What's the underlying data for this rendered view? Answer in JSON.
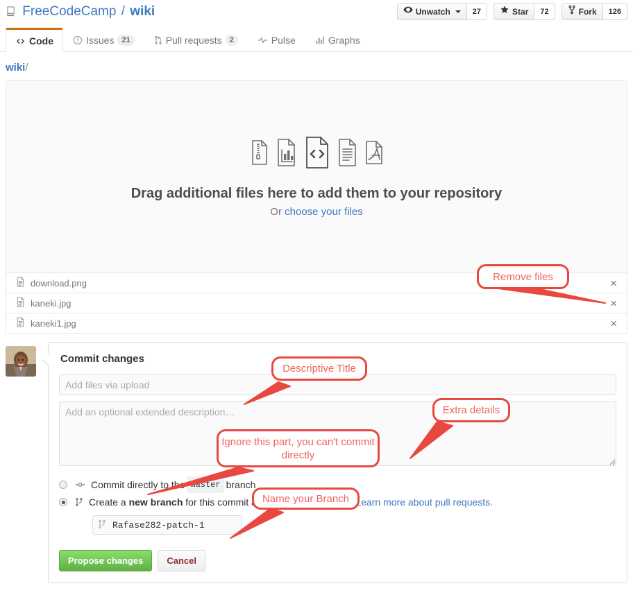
{
  "header": {
    "repo_icon": "repo-forked-icon",
    "owner": "FreeCodeCamp",
    "separator": "/",
    "name": "wiki",
    "actions": [
      {
        "icon": "eye-icon",
        "label": "Unwatch",
        "has_caret": true,
        "count": "27"
      },
      {
        "icon": "star-icon",
        "label": "Star",
        "has_caret": false,
        "count": "72"
      },
      {
        "icon": "fork-icon",
        "label": "Fork",
        "has_caret": false,
        "count": "126"
      }
    ]
  },
  "nav": {
    "tabs": [
      {
        "icon": "code-icon",
        "label": "Code",
        "count": "",
        "selected": true
      },
      {
        "icon": "issue-opened-icon",
        "label": "Issues",
        "count": "21",
        "selected": false
      },
      {
        "icon": "git-pull-request-icon",
        "label": "Pull requests",
        "count": "2",
        "selected": false
      },
      {
        "icon": "pulse-icon",
        "label": "Pulse",
        "count": "",
        "selected": false
      },
      {
        "icon": "graph-icon",
        "label": "Graphs",
        "count": "",
        "selected": false
      }
    ]
  },
  "breadcrumb": {
    "root": "wiki",
    "slash": "/"
  },
  "dropzone": {
    "file_type_icons": [
      "zip-file-icon",
      "spreadsheet-file-icon",
      "code-file-icon",
      "text-file-icon",
      "pdf-file-icon"
    ],
    "title": "Drag additional files here to add them to your repository",
    "or_text": "Or ",
    "choose_link": "choose your files"
  },
  "uploaded_files": [
    {
      "icon": "file-icon",
      "name": "download.png",
      "remove": "×"
    },
    {
      "icon": "file-icon",
      "name": "kaneki.jpg",
      "remove": "×"
    },
    {
      "icon": "file-icon",
      "name": "kaneki1.jpg",
      "remove": "×"
    }
  ],
  "commit": {
    "avatar_name": "user-avatar",
    "heading": "Commit changes",
    "title_placeholder": "Add files via upload",
    "title_value": "",
    "description_placeholder": "Add an optional extended description…",
    "description_value": "",
    "option_direct": {
      "icon": "git-commit-icon",
      "text_before": "Commit directly to the",
      "branch": "master",
      "text_after": "branch",
      "checked": false
    },
    "option_branch": {
      "icon": "git-branch-icon",
      "text_before": "Create a",
      "bold": "new branch",
      "text_after": "for this commit and start a pull request.",
      "link": "Learn more about pull requests.",
      "checked": true
    },
    "branch_name_icon": "git-branch-icon",
    "branch_name_value": "Rafase282-patch-1",
    "propose_label": "Propose changes",
    "cancel_label": "Cancel"
  },
  "annotations": [
    {
      "name": "remove-files",
      "text": "Remove files"
    },
    {
      "name": "descriptive-title",
      "text": "Descriptive Title"
    },
    {
      "name": "extra-details",
      "text": "Extra details"
    },
    {
      "name": "ignore-commit-directly",
      "text": "Ignore this part, you  can't commit directly"
    },
    {
      "name": "name-your-branch",
      "text": "Name your Branch"
    }
  ],
  "colors": {
    "link": "#4078c0",
    "tab_accent": "#d26911",
    "annotation": "#e8483f",
    "primary_button": "#60b044"
  }
}
